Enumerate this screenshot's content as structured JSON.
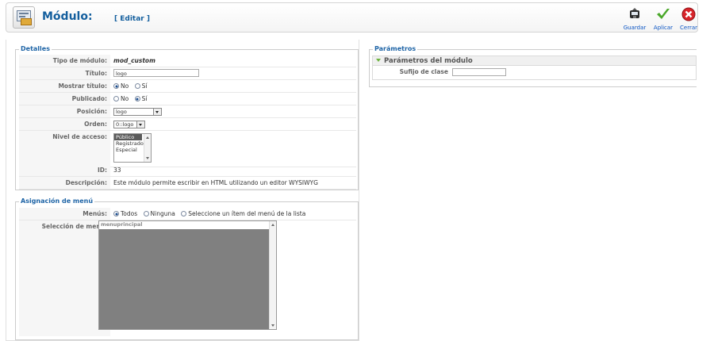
{
  "header": {
    "title": "Módulo:",
    "subtitle": "[ Editar ]"
  },
  "toolbar": {
    "save": "Guardar",
    "apply": "Aplicar",
    "close": "Cerrar"
  },
  "details": {
    "legend": "Detalles",
    "module_type_label": "Tipo de módulo:",
    "module_type": "mod_custom",
    "title_label": "Título:",
    "title_value": "logo",
    "show_title_label": "Mostrar título:",
    "published_label": "Publicado:",
    "no": "No",
    "yes": "Sí",
    "position_label": "Posición:",
    "position_value": "logo",
    "order_label": "Orden:",
    "order_value": "0::logo",
    "access_label": "Nivel de acceso:",
    "access_options": [
      "Público",
      "Registrado",
      "Especial"
    ],
    "id_label": "ID:",
    "id_value": "33",
    "description_label": "Descripción:",
    "description": "Este módulo permite escribir en HTML utilizando un editor WYSIWYG"
  },
  "menu_assignment": {
    "legend": "Asignación de menú",
    "menus_label": "Menús:",
    "all": "Todos",
    "none": "Ninguna",
    "select": "Seleccione un ítem del menú de la lista",
    "selection_label": "Selección de menú:",
    "list_header": "menuprincipal"
  },
  "parameters": {
    "legend": "Parámetros",
    "pane_title": "Parámetros del módulo",
    "class_suffix_label": "Sufijo de clase",
    "class_suffix_value": ""
  },
  "colors": {
    "title": "#145f9e",
    "link": "#0b55c4",
    "legend": "#1e64a6",
    "accent_green": "#6db33f",
    "close_red": "#d8242a"
  }
}
